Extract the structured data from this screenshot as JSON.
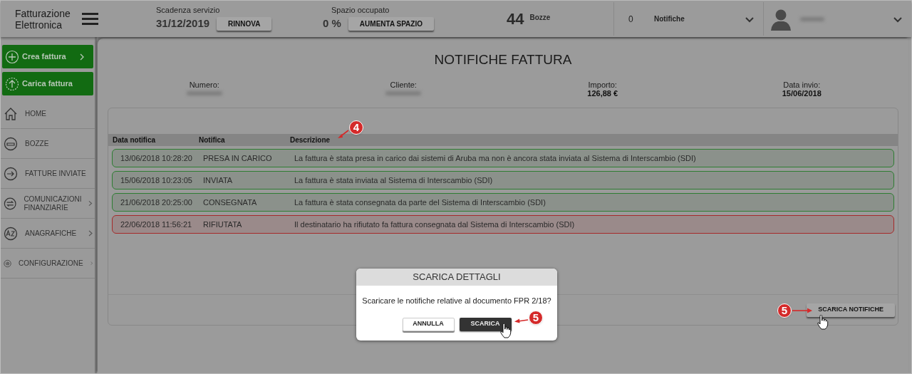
{
  "header": {
    "logo_lines": [
      "Fatturazione",
      "Elettronica"
    ],
    "service": {
      "label": "Scadenza servizio",
      "value": "31/12/2019",
      "button": "RINNOVA"
    },
    "space": {
      "label": "Spazio occupato",
      "value": "0 %",
      "button": "AUMENTA SPAZIO"
    },
    "drafts": {
      "count": "44",
      "label": "Bozze"
    },
    "notifications": {
      "count": "0",
      "label": "Notifiche"
    }
  },
  "sidebar": {
    "actions": [
      {
        "label": "Crea fattura",
        "has_arrow": true
      },
      {
        "label": "Carica fattura",
        "has_arrow": false
      }
    ],
    "items": [
      {
        "label": "HOME",
        "has_arrow": false
      },
      {
        "label": "BOZZE",
        "has_arrow": false
      },
      {
        "label": "FATTURE INVIATE",
        "has_arrow": false
      },
      {
        "label": "COMUNICAZIONI FINANZIARIE",
        "has_arrow": true
      },
      {
        "label": "ANAGRAFICHE",
        "has_arrow": true
      },
      {
        "label": "CONFIGURAZIONE",
        "has_arrow": true
      }
    ]
  },
  "page": {
    "title": "NOTIFICHE FATTURA",
    "fields": [
      {
        "label": "Numero:"
      },
      {
        "label": "Cliente:"
      },
      {
        "label": "Importo:",
        "value": "126,88 €"
      },
      {
        "label": "Data invio:",
        "value": "15/06/2018"
      }
    ]
  },
  "table": {
    "columns": [
      "Data notifica",
      "Notifica",
      "Descrizione"
    ],
    "rows": [
      {
        "date": "13/06/2018 10:28:20",
        "type": "PRESA IN CARICO",
        "description": "La fattura è stata presa in carico dai sistemi di Aruba ma non è ancora stata inviata al Sistema di Interscambio (SDI)",
        "kind": "ok"
      },
      {
        "date": "15/06/2018 10:23:05",
        "type": "INVIATA",
        "description": "La fattura è stata inviata al Sistema di Interscambio (SDI)",
        "kind": "ok"
      },
      {
        "date": "21/06/2018 20:25:00",
        "type": "CONSEGNATA",
        "description": "La fattura è stata consegnata da parte del Sistema di Interscambio (SDI)",
        "kind": "ok"
      },
      {
        "date": "22/06/2018 11:56:21",
        "type": "RIFIUTATA",
        "description": "Il destinatario ha rifiutato fa fattura consegnata dal Sistema di Interscambio (SDI)",
        "kind": "error"
      }
    ]
  },
  "download_button": "SCARICA NOTIFICHE",
  "dialog": {
    "title": "SCARICA DETTAGLI",
    "message": "Scaricare le notifiche relative al documento FPR 2/18?",
    "buttons": [
      {
        "label": "ANNULLA",
        "kind": "secondary"
      },
      {
        "label": "SCARICA",
        "kind": "primary"
      }
    ]
  },
  "annotations": [
    {
      "label": "4"
    },
    {
      "label": "5"
    },
    {
      "label": "5"
    }
  ]
}
